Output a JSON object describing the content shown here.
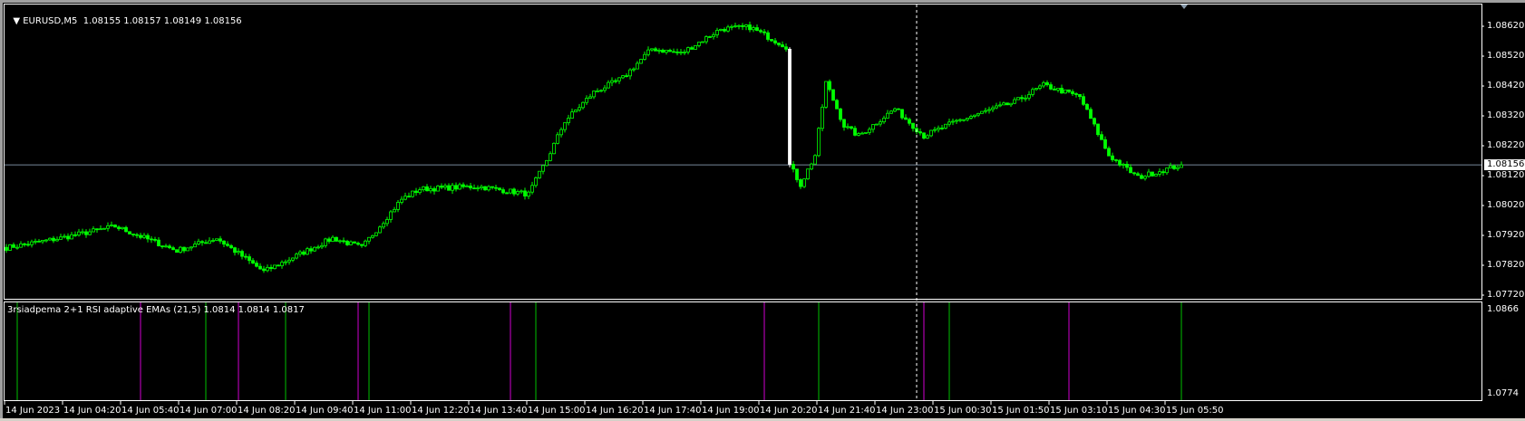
{
  "header": {
    "symbol": "EURUSD,M5",
    "ohlc": "1.08155 1.08157 1.08149 1.08156",
    "menu_icon": "triangle-down-icon"
  },
  "price_axis": {
    "labels": [
      "1.08620",
      "1.08520",
      "1.08420",
      "1.08320",
      "1.08220",
      "1.08120",
      "1.08020",
      "1.07920",
      "1.07820",
      "1.07720"
    ],
    "current_price": "1.08156",
    "current_value": 1.08156,
    "max": 1.0862,
    "min": 1.0772
  },
  "indicator": {
    "title": "3rsiadpema 2+1 RSI adaptive EMAs (21,5) 1.0814 1.0814 1.0817",
    "axis_max": "1.0866",
    "axis_min": "1.0774",
    "signals": [
      {
        "bar": 3,
        "type": "buy"
      },
      {
        "bar": 37,
        "type": "sell"
      },
      {
        "bar": 55,
        "type": "buy"
      },
      {
        "bar": 64,
        "type": "sell"
      },
      {
        "bar": 77,
        "type": "buy"
      },
      {
        "bar": 97,
        "type": "sell"
      },
      {
        "bar": 100,
        "type": "buy"
      },
      {
        "bar": 139,
        "type": "sell"
      },
      {
        "bar": 146,
        "type": "buy"
      },
      {
        "bar": 209,
        "type": "sell"
      },
      {
        "bar": 224,
        "type": "buy"
      },
      {
        "bar": 253,
        "type": "sell"
      },
      {
        "bar": 260,
        "type": "buy"
      },
      {
        "bar": 293,
        "type": "sell"
      },
      {
        "bar": 324,
        "type": "buy"
      }
    ],
    "colors": {
      "buy": "#008000",
      "sell": "#8b008b"
    }
  },
  "time_axis": {
    "labels": [
      "14 Jun 2023",
      "14 Jun 04:20",
      "14 Jun 05:40",
      "14 Jun 07:00",
      "14 Jun 08:20",
      "14 Jun 09:40",
      "14 Jun 11:00",
      "14 Jun 12:20",
      "14 Jun 13:40",
      "14 Jun 15:00",
      "14 Jun 16:20",
      "14 Jun 17:40",
      "14 Jun 19:00",
      "14 Jun 20:20",
      "14 Jun 21:40",
      "14 Jun 23:00",
      "15 Jun 00:30",
      "15 Jun 01:50",
      "15 Jun 03:10",
      "15 Jun 04:30",
      "15 Jun 05:50"
    ]
  },
  "crosshair_bar": 251,
  "chart_data": {
    "type": "candlestick",
    "timeframe": "M5",
    "close_waypoints": [
      [
        0,
        1.07879
      ],
      [
        15,
        1.07911
      ],
      [
        30,
        1.0795
      ],
      [
        47,
        1.07869
      ],
      [
        58,
        1.07911
      ],
      [
        71,
        1.07799
      ],
      [
        90,
        1.07911
      ],
      [
        98,
        1.07879
      ],
      [
        109,
        1.08041
      ],
      [
        114,
        1.08075
      ],
      [
        130,
        1.08084
      ],
      [
        144,
        1.08058
      ],
      [
        149,
        1.08172
      ],
      [
        154,
        1.08302
      ],
      [
        162,
        1.08399
      ],
      [
        170,
        1.08447
      ],
      [
        178,
        1.08545
      ],
      [
        186,
        1.08529
      ],
      [
        197,
        1.08611
      ],
      [
        205,
        1.08617
      ],
      [
        215,
        1.08552
      ],
      [
        216,
        1.08156
      ],
      [
        219,
        1.0809
      ],
      [
        223,
        1.08188
      ],
      [
        226,
        1.08432
      ],
      [
        231,
        1.08287
      ],
      [
        235,
        1.08253
      ],
      [
        245,
        1.08344
      ],
      [
        253,
        1.08253
      ],
      [
        262,
        1.08302
      ],
      [
        270,
        1.08335
      ],
      [
        278,
        1.08366
      ],
      [
        286,
        1.08423
      ],
      [
        296,
        1.08384
      ],
      [
        304,
        1.08188
      ],
      [
        312,
        1.08114
      ],
      [
        324,
        1.08156
      ]
    ],
    "colors": {
      "bull": "#00ff00",
      "bear": "#00ff00",
      "line": "#778899"
    }
  }
}
